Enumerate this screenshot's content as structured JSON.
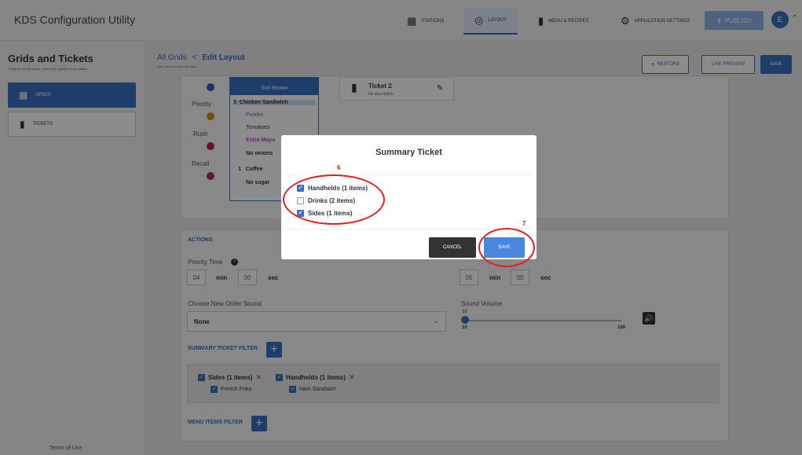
{
  "app": {
    "title": "KDS Configuration Utility"
  },
  "nav": {
    "stations": "STATIONS",
    "layout": "LAYOUT",
    "menu_recipes": "MENU & RECIPES",
    "app_settings": "APPLICATION SETTINGS",
    "publish": "PUBLISH",
    "avatar": "E"
  },
  "sidebar": {
    "title": "Grids and Tickets",
    "subtitle": "Create or modify layout views to be applied to any station",
    "items": [
      {
        "label": "GRIDS"
      },
      {
        "label": "TICKETS"
      }
    ],
    "terms": "Terms of Use"
  },
  "header": {
    "breadcrumb_root": "All Grids",
    "sep": "<",
    "title": "Edit Layout",
    "subtitle": "Here you can edit your data.",
    "restore": "RESTORE",
    "live_preview": "LIVE PREVIEW",
    "save": "SAVE"
  },
  "preview": {
    "priorities": [
      "Priority",
      "Rush",
      "Recall"
    ],
    "ticket_head": "Suri Brown",
    "lines": [
      {
        "qty": "3",
        "text": "Chicken Sandwich"
      },
      {
        "qty": "",
        "text": "Pickles"
      },
      {
        "qty": "",
        "text": "Tomatoes"
      },
      {
        "qty": "",
        "text": "Extra Mayo"
      },
      {
        "qty": "",
        "text": "No onions"
      },
      {
        "qty": "1",
        "text": "Coffee"
      },
      {
        "qty": "",
        "text": "No sugar"
      }
    ],
    "ticket2_title": "Ticket 2",
    "ticket2_desc": "No description"
  },
  "actions": {
    "section": "ACTIONS",
    "priority_time_label": "Priority Time",
    "priority_min": "04",
    "priority_sec": "00",
    "rush_min": "05",
    "rush_sec": "00",
    "min": "min",
    "sec": "sec",
    "sound_label": "Choose New Order Sound",
    "sound_value": "None",
    "volume_label": "Sound Volume",
    "volume_value": "10",
    "volume_min": "10",
    "volume_max": "100",
    "volume_level": 0.0
  },
  "summary_filter": {
    "label": "SUMMARY TICKET FILTER",
    "chips": [
      {
        "label": "Sides (1 items)",
        "sub": "French Fries"
      },
      {
        "label": "Handhelds (1 items)",
        "sub": "Ham Sandwich"
      }
    ]
  },
  "menu_filter": {
    "label": "MENU ITEMS FILTER"
  },
  "modal": {
    "title": "Summary Ticket",
    "options": [
      {
        "label": "Handhelds (1 items)",
        "checked": true
      },
      {
        "label": "Drinks (2 items)",
        "checked": false
      },
      {
        "label": "Sides (1 items)",
        "checked": true
      }
    ],
    "cancel": "CANCEL",
    "save": "SAVE"
  },
  "annotations": {
    "num6": "6",
    "num7": "7"
  },
  "colors": {
    "accent": "#3a6fc4",
    "annotation": "#e02020",
    "priority": "#2f5fc4",
    "rush_dot": "#d98c1a",
    "rush2": "#c0263a",
    "recall": "#b02580"
  }
}
